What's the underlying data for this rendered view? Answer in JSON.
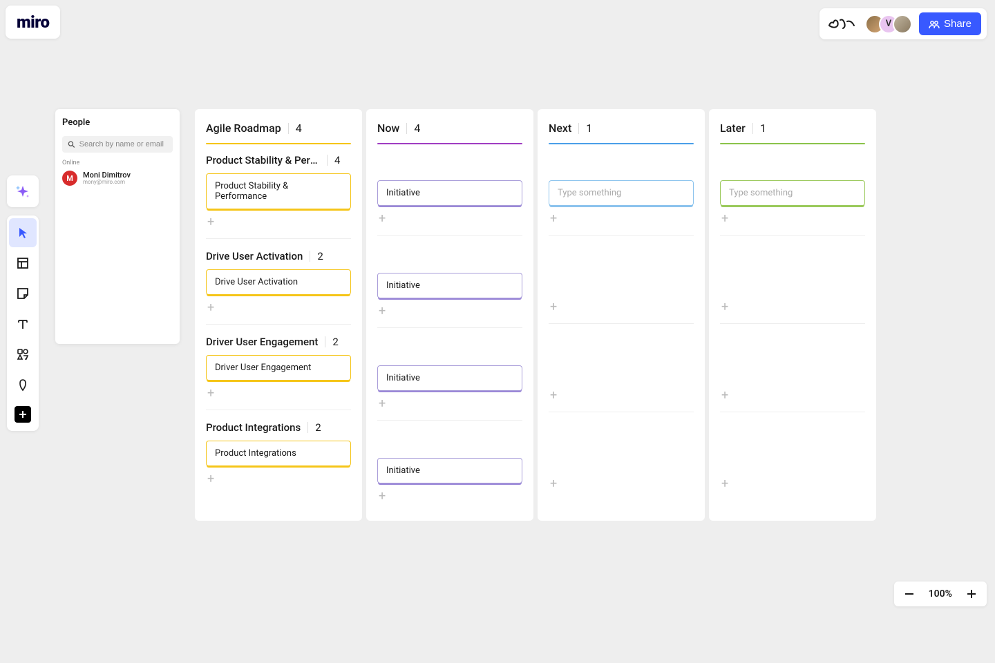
{
  "logo": "miro",
  "header": {
    "share_label": "Share",
    "avatars": [
      {
        "letter": ""
      },
      {
        "letter": "V"
      },
      {
        "letter": ""
      }
    ]
  },
  "people_panel": {
    "title": "People",
    "search_placeholder": "Search by name or email",
    "online_label": "Online",
    "people": [
      {
        "initial": "M",
        "name": "Moni Dimitrov",
        "email": "mony@miro.com"
      }
    ]
  },
  "board": {
    "columns": [
      {
        "title": "Agile Roadmap",
        "count": "4",
        "color": "yellow",
        "sections": [
          {
            "title": "Product Stability & Perfor…",
            "count": "4",
            "cards": [
              {
                "text": "Product Stability & Performance",
                "color": "yellow"
              }
            ]
          },
          {
            "title": "Drive User Activation",
            "count": "2",
            "cards": [
              {
                "text": "Drive User Activation",
                "color": "yellow"
              }
            ]
          },
          {
            "title": "Driver User Engagement",
            "count": "2",
            "cards": [
              {
                "text": "Driver User Engagement",
                "color": "yellow"
              }
            ]
          },
          {
            "title": "Product Integrations",
            "count": "2",
            "cards": [
              {
                "text": "Product Integrations",
                "color": "yellow"
              }
            ]
          }
        ]
      },
      {
        "title": "Now",
        "count": "4",
        "color": "purple",
        "sections": [
          {
            "cards": [
              {
                "text": "Initiative",
                "color": "purple"
              }
            ]
          },
          {
            "cards": [
              {
                "text": "Initiative",
                "color": "purple"
              }
            ]
          },
          {
            "cards": [
              {
                "text": "Initiative",
                "color": "purple"
              }
            ]
          },
          {
            "cards": [
              {
                "text": "Initiative",
                "color": "purple"
              }
            ]
          }
        ]
      },
      {
        "title": "Next",
        "count": "1",
        "color": "blue",
        "sections": [
          {
            "cards": [
              {
                "text": "Type something",
                "color": "blue",
                "placeholder": true
              }
            ]
          },
          {
            "cards": []
          },
          {
            "cards": []
          },
          {
            "cards": []
          }
        ]
      },
      {
        "title": "Later",
        "count": "1",
        "color": "green",
        "sections": [
          {
            "cards": [
              {
                "text": "Type something",
                "color": "green",
                "placeholder": true
              }
            ]
          },
          {
            "cards": []
          },
          {
            "cards": []
          },
          {
            "cards": []
          }
        ]
      }
    ]
  },
  "zoom": {
    "level": "100%"
  }
}
